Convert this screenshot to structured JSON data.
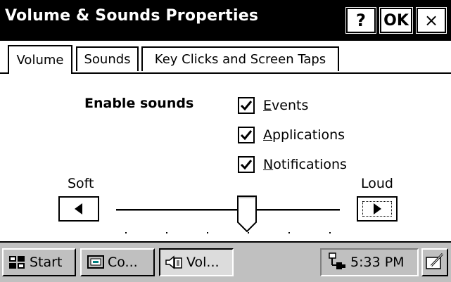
{
  "window": {
    "title": "Volume & Sounds Properties",
    "help_label": "?",
    "ok_label": "OK",
    "close_label": "×"
  },
  "tabs": [
    {
      "label": "Volume",
      "active": true
    },
    {
      "label": "Sounds",
      "active": false
    },
    {
      "label": "Key Clicks and Screen Taps",
      "active": false
    }
  ],
  "sounds": {
    "heading": "Enable sounds",
    "options": [
      {
        "label": "Events",
        "mnemonic": "E",
        "rest": "vents",
        "checked": true
      },
      {
        "label": "Applications",
        "mnemonic": "A",
        "rest": "pplications",
        "checked": true
      },
      {
        "label": "Notifications",
        "mnemonic": "N",
        "rest": "otifications",
        "checked": true
      }
    ]
  },
  "volume": {
    "soft_label": "Soft",
    "loud_label": "Loud",
    "level_fraction": 0.6
  },
  "taskbar": {
    "start_label": "Start",
    "items": [
      {
        "label": "Co...",
        "icon": "control-panel-icon",
        "pressed": false
      },
      {
        "label": "Vol...",
        "icon": "volume-icon",
        "pressed": true
      }
    ],
    "clock": "5:33 PM",
    "tray_icon": "network-connection-icon",
    "sip_icon": "input-panel-icon"
  }
}
